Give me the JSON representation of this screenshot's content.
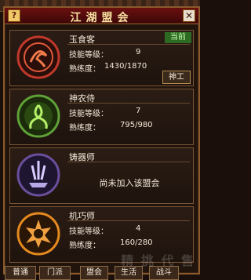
{
  "window": {
    "title": "江湖盟会",
    "help_label": "?",
    "close_label": "✕"
  },
  "professions": [
    {
      "name": "玉食客",
      "status_badge": "当前",
      "skill_label": "技能等级：",
      "skill_level": "9",
      "proficiency_label": "熟练度：",
      "proficiency_value": "1430/1870",
      "action_label": "神工",
      "icon": "food-emblem-icon",
      "color": "#c0392b"
    },
    {
      "name": "神农侍",
      "skill_label": "技能等级：",
      "skill_level": "7",
      "proficiency_label": "熟练度：",
      "proficiency_value": "795/980",
      "icon": "herb-emblem-icon",
      "color": "#5fa038"
    },
    {
      "name": "铸器师",
      "message": "尚未加入该盟会",
      "icon": "forge-emblem-icon",
      "color": "#6b4e9c"
    },
    {
      "name": "机巧师",
      "skill_label": "技能等级：",
      "skill_level": "4",
      "proficiency_label": "熟练度：",
      "proficiency_value": "160/280",
      "icon": "gear-emblem-icon",
      "color": "#e58a1f"
    }
  ],
  "tabs": [
    "普通",
    "门派",
    "盟会",
    "生活",
    "战斗"
  ],
  "watermark": "精 挑 代 售"
}
